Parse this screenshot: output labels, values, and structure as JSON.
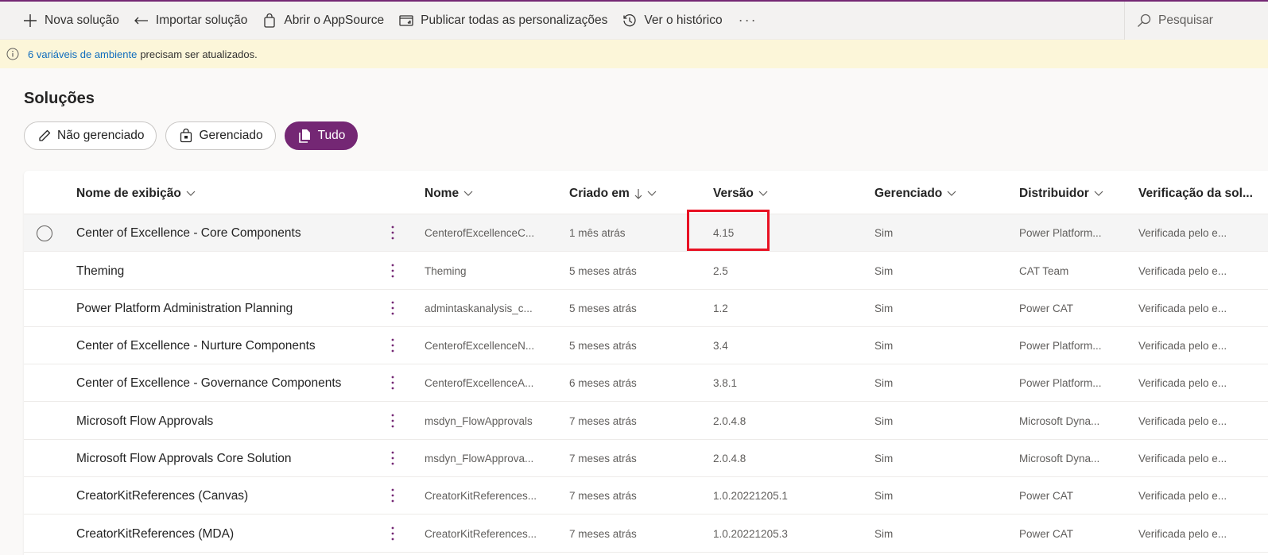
{
  "commandbar": {
    "new_solution": "Nova solução",
    "import_solution": "Importar solução",
    "open_appsource": "Abrir o AppSource",
    "publish_all": "Publicar todas as personalizações",
    "history": "Ver o histórico",
    "more": "···",
    "search_placeholder": "Pesquisar"
  },
  "banner": {
    "link": "6 variáveis de ambiente",
    "text": "precisam ser atualizados."
  },
  "page_title": "Soluções",
  "filters": [
    {
      "label": "Não gerenciado",
      "icon": "pencil-icon",
      "active": false
    },
    {
      "label": "Gerenciado",
      "icon": "bag-lock-icon",
      "active": false
    },
    {
      "label": "Tudo",
      "icon": "documents-icon",
      "active": true
    }
  ],
  "columns": {
    "display_name": "Nome de exibição",
    "name": "Nome",
    "created": "Criado em",
    "version": "Versão",
    "managed": "Gerenciado",
    "publisher": "Distribuidor",
    "check": "Verificação da sol..."
  },
  "rows": [
    {
      "display": "Center of Excellence - Core Components",
      "name": "CenterofExcellenceC...",
      "created": "1 mês atrás",
      "version": "4.15",
      "managed": "Sim",
      "publisher": "Power Platform...",
      "check": "Verificada pelo e..."
    },
    {
      "display": "Theming",
      "name": "Theming",
      "created": "5 meses atrás",
      "version": "2.5",
      "managed": "Sim",
      "publisher": "CAT Team",
      "check": "Verificada pelo e..."
    },
    {
      "display": "Power Platform Administration Planning",
      "name": "admintaskanalysis_c...",
      "created": "5 meses atrás",
      "version": "1.2",
      "managed": "Sim",
      "publisher": "Power CAT",
      "check": "Verificada pelo e..."
    },
    {
      "display": "Center of Excellence - Nurture Components",
      "name": "CenterofExcellenceN...",
      "created": "5 meses atrás",
      "version": "3.4",
      "managed": "Sim",
      "publisher": "Power Platform...",
      "check": "Verificada pelo e..."
    },
    {
      "display": "Center of Excellence - Governance Components",
      "name": "CenterofExcellenceA...",
      "created": "6 meses atrás",
      "version": "3.8.1",
      "managed": "Sim",
      "publisher": "Power Platform...",
      "check": "Verificada pelo e..."
    },
    {
      "display": "Microsoft Flow Approvals",
      "name": "msdyn_FlowApprovals",
      "created": "7 meses atrás",
      "version": "2.0.4.8",
      "managed": "Sim",
      "publisher": "Microsoft Dyna...",
      "check": "Verificada pelo e..."
    },
    {
      "display": "Microsoft Flow Approvals Core Solution",
      "name": "msdyn_FlowApprova...",
      "created": "7 meses atrás",
      "version": "2.0.4.8",
      "managed": "Sim",
      "publisher": "Microsoft Dyna...",
      "check": "Verificada pelo e..."
    },
    {
      "display": "CreatorKitReferences (Canvas)",
      "name": "CreatorKitReferences...",
      "created": "7 meses atrás",
      "version": "1.0.20221205.1",
      "managed": "Sim",
      "publisher": "Power CAT",
      "check": "Verificada pelo e..."
    },
    {
      "display": "CreatorKitReferences (MDA)",
      "name": "CreatorKitReferences...",
      "created": "7 meses atrás",
      "version": "1.0.20221205.3",
      "managed": "Sim",
      "publisher": "Power CAT",
      "check": "Verificada pelo e..."
    }
  ],
  "colors": {
    "accent": "#742774",
    "highlight": "#e81123",
    "banner": "#fcf6d9",
    "link": "#0f6cbd"
  }
}
